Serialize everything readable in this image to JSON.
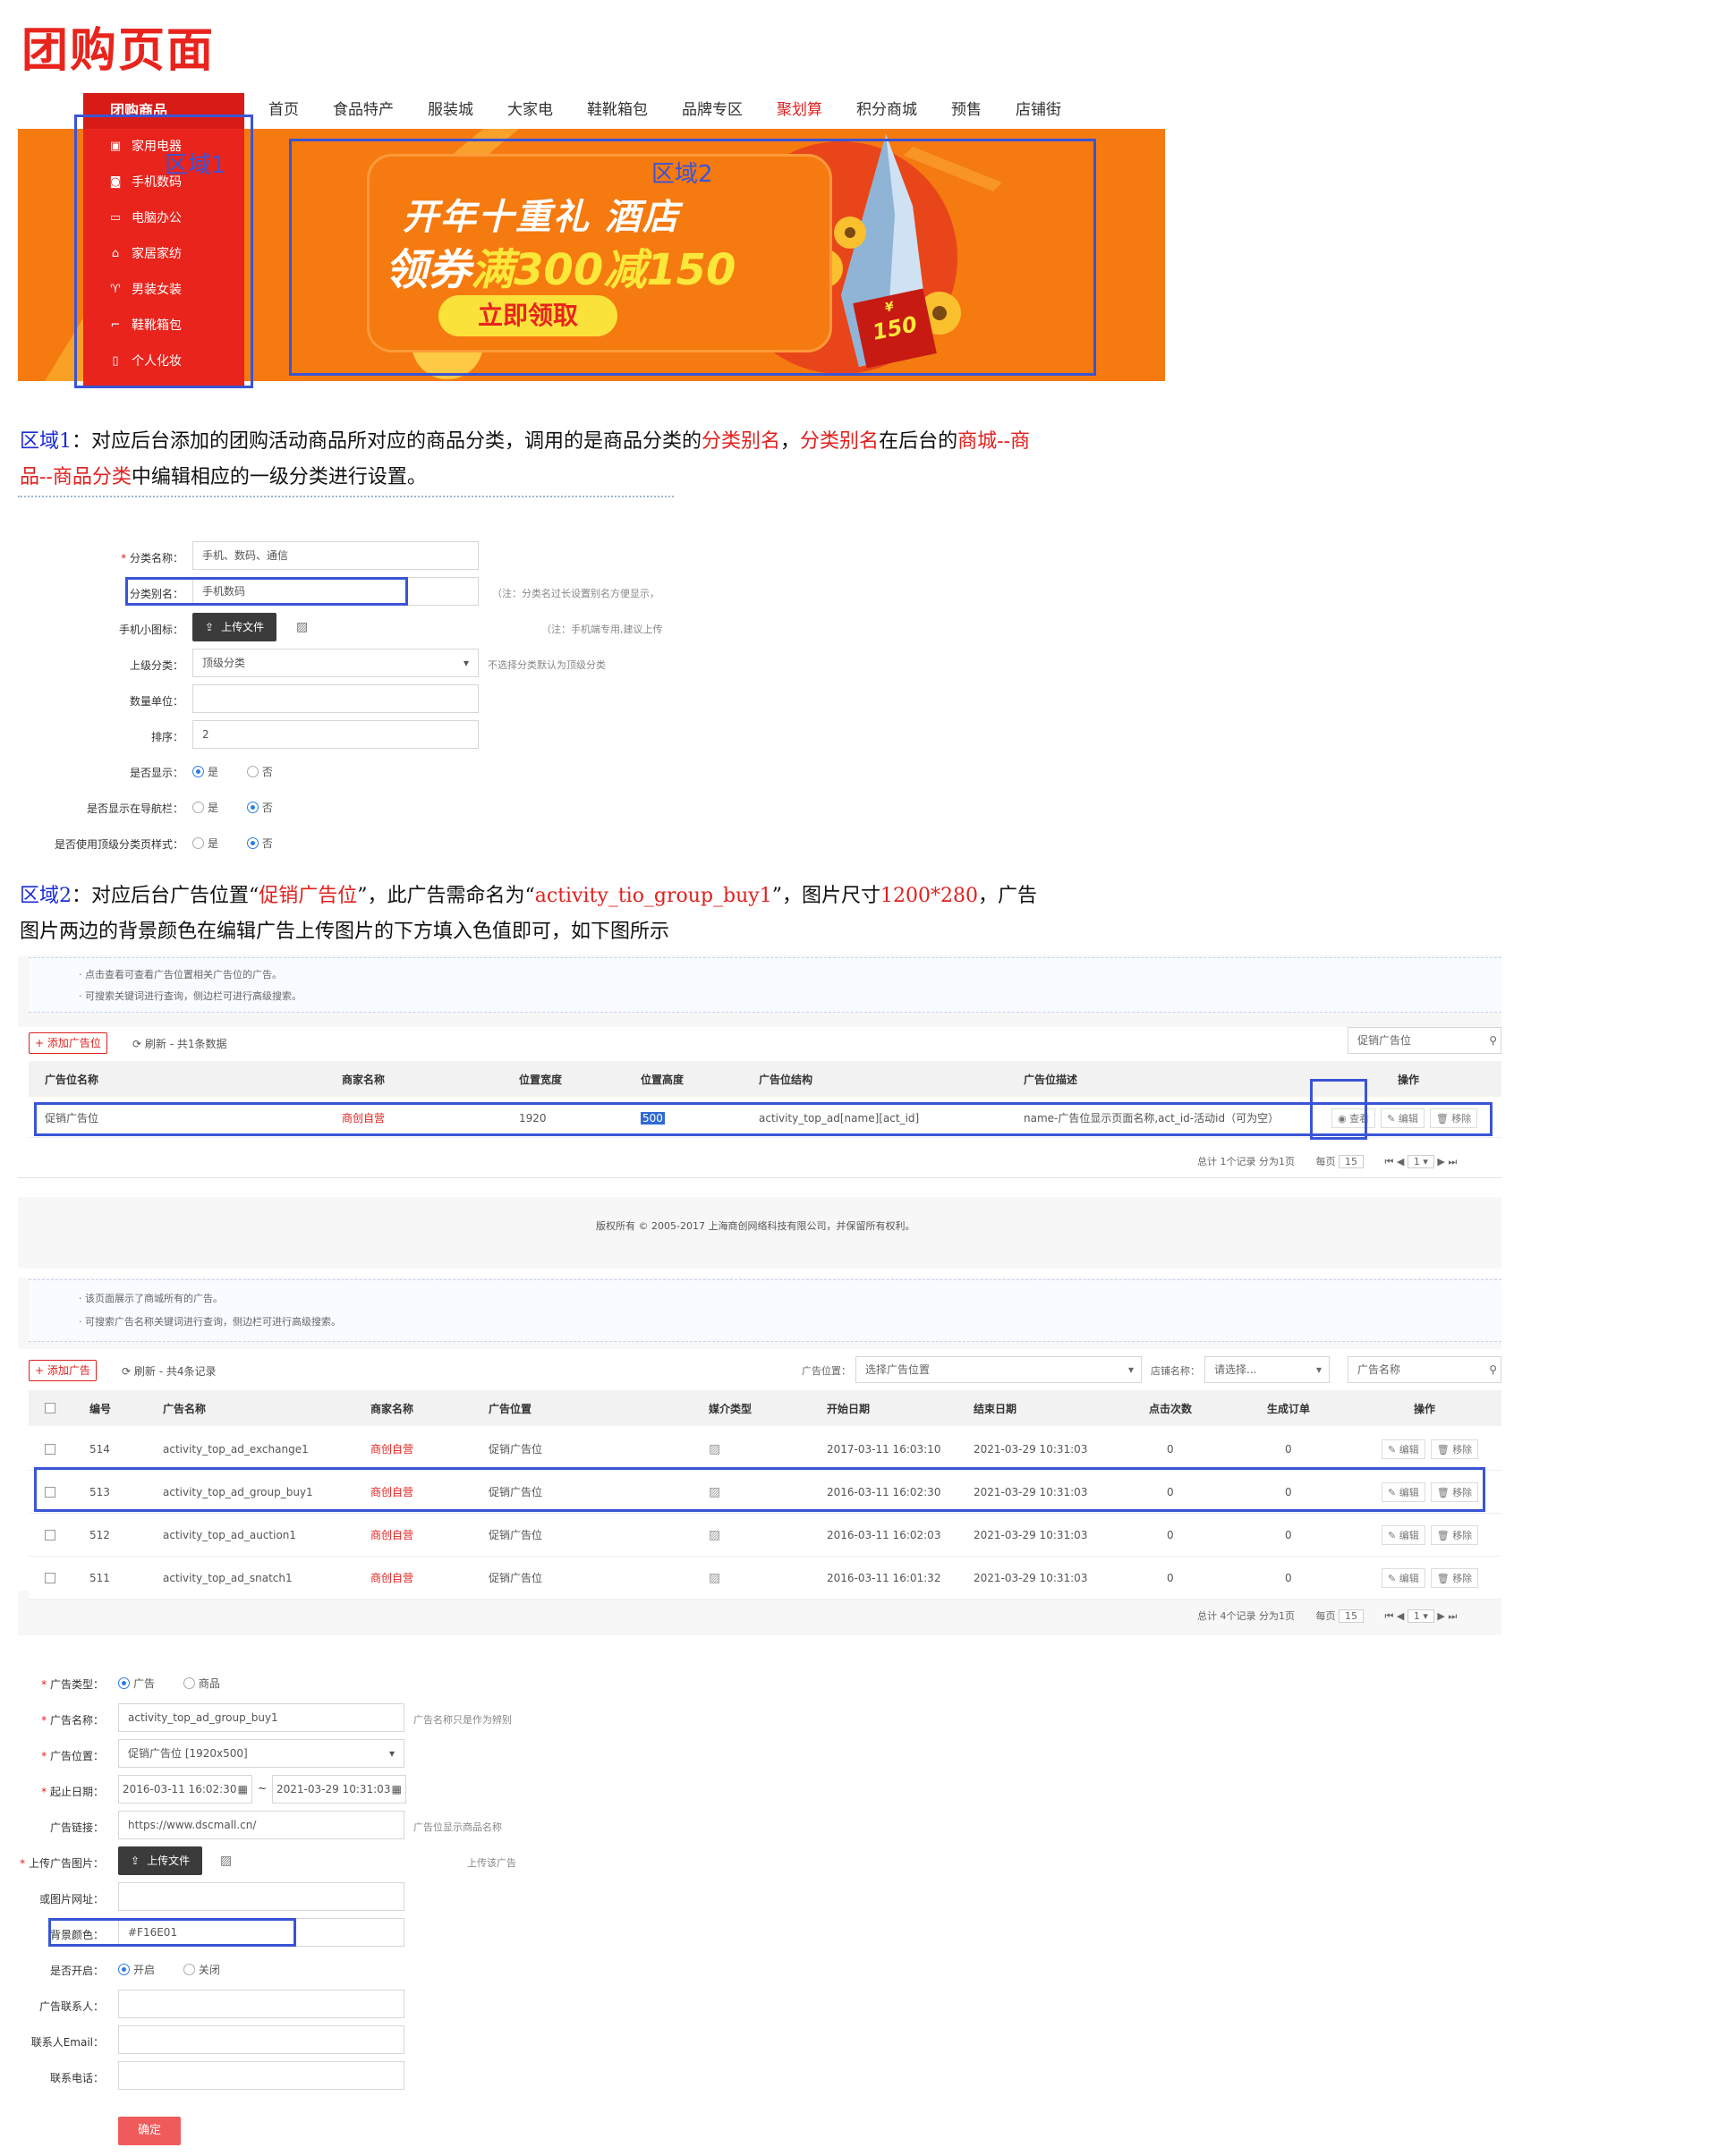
{
  "title": "团购页面",
  "nav": [
    "首页",
    "食品特产",
    "服装城",
    "大家电",
    "鞋靴箱包",
    "品牌专区",
    "聚划算",
    "积分商城",
    "预售",
    "店铺街"
  ],
  "nav_highlight_index": 6,
  "sidebar": {
    "heading": "团购商品",
    "items": [
      {
        "label": "家用电器",
        "icon": "appliance-icon"
      },
      {
        "label": "手机数码",
        "icon": "camera-icon"
      },
      {
        "label": "电脑办公",
        "icon": "monitor-icon"
      },
      {
        "label": "家居家纺",
        "icon": "sofa-icon"
      },
      {
        "label": "男装女装",
        "icon": "shirt-icon"
      },
      {
        "label": "鞋靴箱包",
        "icon": "shoe-icon"
      },
      {
        "label": "个人化妆",
        "icon": "bottle-icon"
      }
    ]
  },
  "banner": {
    "line1": "开年十重礼 酒店",
    "line2_prefix": "领券",
    "line2_highlight": "满300减150",
    "button": "立即领取",
    "coupon": "150",
    "coupon_symbol": "¥"
  },
  "zone_labels": {
    "zone1": "区域1",
    "zone2": "区域2"
  },
  "para1": {
    "zone": "区域1",
    "t1": "：对应后台添加的团购活动商品所对应的商品分类，调用的是商品分类的",
    "r1": "分类别名",
    "t2": "，",
    "r2": "分类别名",
    "t3": "在后台的",
    "r3": "商城--商",
    "r4": "品--商品分类",
    "t4": "中编辑相应的一级分类进行设置。"
  },
  "form1": {
    "fields": [
      {
        "label": "分类名称：",
        "value": "手机、数码、通信",
        "required": true
      },
      {
        "label": "分类别名：",
        "value": "手机数码",
        "note": "（注：分类名过长设置别名方便显示，"
      },
      {
        "label": "手机小图标：",
        "button": "上传文件",
        "note": "（注：手机端专用,建议上传"
      },
      {
        "label": "上级分类：",
        "value": "顶级分类",
        "note": "不选择分类默认为顶级分类"
      },
      {
        "label": "数量单位：",
        "value": ""
      },
      {
        "label": "排序：",
        "value": "2"
      }
    ],
    "radios": [
      {
        "label": "是否显示：",
        "yes": "是",
        "no": "否",
        "selected": "yes"
      },
      {
        "label": "是否显示在导航栏：",
        "yes": "是",
        "no": "否",
        "selected": "no"
      },
      {
        "label": "是否使用顶级分类页样式：",
        "yes": "是",
        "no": "否",
        "selected": "no"
      }
    ]
  },
  "para2": {
    "zone": "区域2",
    "t1": "：对应后台广告位置“",
    "r1": "促销广告位",
    "t2": "”，此广告需命名为“",
    "r2": "activity_tio_group_buy1",
    "t3": "”，图片尺寸",
    "r3": "1200*280",
    "t4": "，广告",
    "line2": "图片两边的背景颜色在编辑广告上传图片的下方填入色值即可，如下图所示"
  },
  "table1": {
    "tips": [
      "点击查看可查看广告位置相关广告位的广告。",
      "可搜索关键词进行查询，侧边栏可进行高级搜索。"
    ],
    "add": "+ 添加广告位",
    "refresh": "刷新 - 共1条数据",
    "search": "促销广告位",
    "headers": [
      "广告位名称",
      "商家名称",
      "位置宽度",
      "位置高度",
      "广告位结构",
      "广告位描述",
      "操作"
    ],
    "row": {
      "name": "促销广告位",
      "merchant": "商创自营",
      "width": "1920",
      "height": "500",
      "structure": "activity_top_ad[name][act_id]",
      "desc": "name-广告位显示页面名称,act_id-活动id（可为空）",
      "view": "查看",
      "edit": "编辑",
      "remove": "移除"
    },
    "pager": {
      "summary": "总计 1个记录 分为1页",
      "per": "每页",
      "per_value": "15",
      "page": "1"
    },
    "copyright": "版权所有 © 2005-2017 上海商创网络科技有限公司，并保留所有权利。"
  },
  "table2": {
    "tips": [
      "该页面展示了商城所有的广告。",
      "可搜索广告名称关键词进行查询，侧边栏可进行高级搜索。"
    ],
    "add": "+ 添加广告",
    "refresh": "刷新 - 共4条记录",
    "filter1_label": "广告位置：",
    "filter1": "选择广告位置",
    "filter2_label": "店铺名称：",
    "filter2": "请选择...",
    "search": "广告名称",
    "headers": [
      "编号",
      "广告名称",
      "商家名称",
      "广告位置",
      "媒介类型",
      "开始日期",
      "结束日期",
      "点击次数",
      "生成订单",
      "操作"
    ],
    "rows": [
      {
        "id": "514",
        "name": "activity_top_ad_exchange1",
        "merchant": "商创自营",
        "pos": "促销广告位",
        "start": "2017-03-11 16:03:10",
        "end": "2021-03-29 10:31:03",
        "clicks": "0",
        "orders": "0"
      },
      {
        "id": "513",
        "name": "activity_top_ad_group_buy1",
        "merchant": "商创自营",
        "pos": "促销广告位",
        "start": "2016-03-11 16:02:30",
        "end": "2021-03-29 10:31:03",
        "clicks": "0",
        "orders": "0"
      },
      {
        "id": "512",
        "name": "activity_top_ad_auction1",
        "merchant": "商创自营",
        "pos": "促销广告位",
        "start": "2016-03-11 16:02:03",
        "end": "2021-03-29 10:31:03",
        "clicks": "0",
        "orders": "0"
      },
      {
        "id": "511",
        "name": "activity_top_ad_snatch1",
        "merchant": "商创自营",
        "pos": "促销广告位",
        "start": "2016-03-11 16:01:32",
        "end": "2021-03-29 10:31:03",
        "clicks": "0",
        "orders": "0"
      }
    ],
    "edit": "编辑",
    "remove": "移除",
    "pager": {
      "summary": "总计 4个记录 分为1页",
      "per": "每页",
      "per_value": "15",
      "page": "1"
    }
  },
  "form2": {
    "type_label": "广告类型：",
    "type_ad": "广告",
    "type_goods": "商品",
    "name_label": "广告名称：",
    "name_value": "activity_top_ad_group_buy1",
    "name_note": "广告名称只是作为辨别",
    "pos_label": "广告位置：",
    "pos_value": "促销广告位 [1920x500]",
    "date_label": "起止日期：",
    "date_start": "2016-03-11 16:02:30",
    "date_sep": "~",
    "date_end": "2021-03-29 10:31:03",
    "link_label": "广告链接：",
    "link_value": "https://www.dscmall.cn/",
    "link_note": "广告位显示商品名称",
    "upload_label": "上传广告图片：",
    "upload_btn": "上传文件",
    "upload_note": "上传该广告",
    "url_label": "或图片网址：",
    "url_value": "",
    "bg_label": "背景颜色：",
    "bg_value": "#F16E01",
    "open_label": "是否开启：",
    "open_on": "开启",
    "open_off": "关闭",
    "contact_label": "广告联系人：",
    "email_label": "联系人Email：",
    "phone_label": "联系电话：",
    "submit": "确定"
  },
  "colors": {
    "brand_red": "#e8241d",
    "banner_orange": "#f57a10",
    "annotation_blue": "#3a54d6",
    "ad_bg_value": "#F16E01"
  }
}
